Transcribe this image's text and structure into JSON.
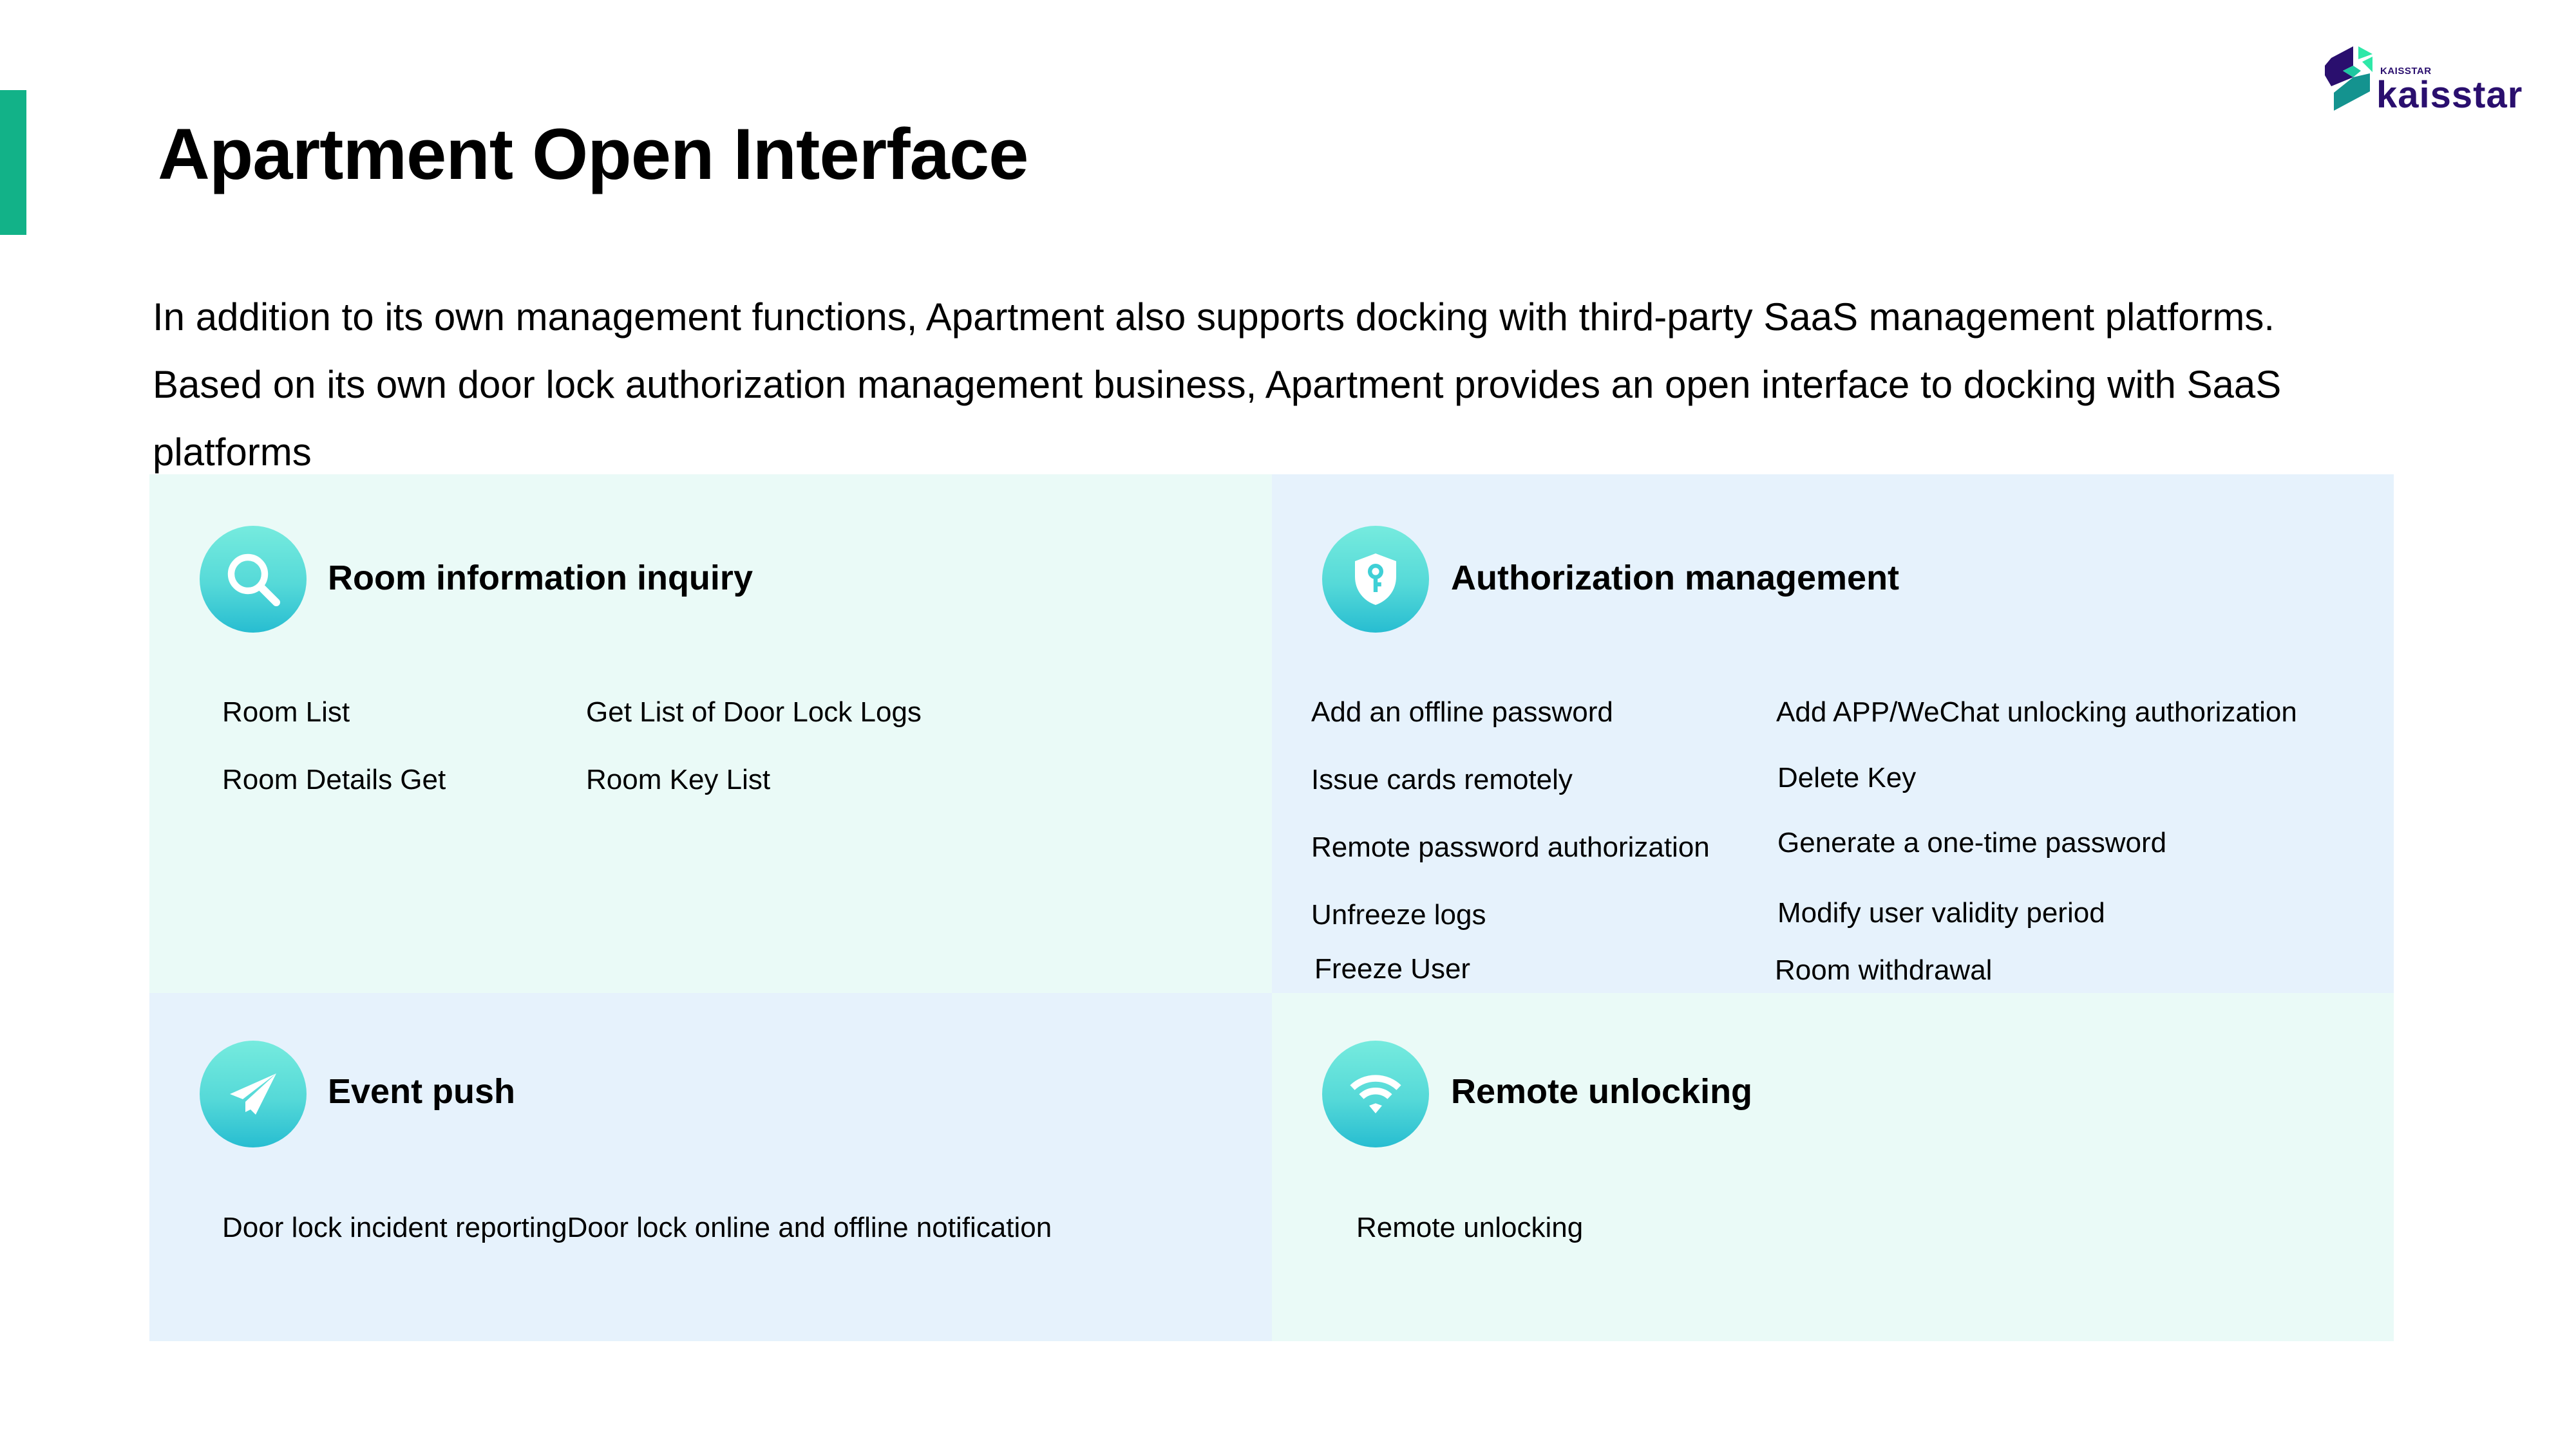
{
  "header": {
    "title": "Apartment Open Interface",
    "logo": {
      "small_text": "KAISSTAR",
      "wordmark": "kaisstar"
    },
    "intro_lines": [
      "In addition to its own management functions, Apartment also supports docking with third-party SaaS management platforms.",
      "Based on its own door lock authorization management business, Apartment provides an open interface to docking with SaaS",
      "platforms"
    ]
  },
  "colors": {
    "accent": "#12b288",
    "brand_dark": "#2a0f6e",
    "icon_gradient_top": "#76ebde",
    "icon_gradient_bottom": "#27bdd1",
    "panel_mint": "#eafaf7",
    "panel_blue": "#e6f2fc"
  },
  "panels": [
    {
      "title": "Room information inquiry",
      "icon": "search-icon",
      "items": [
        "Room List",
        "Get List of Door Lock Logs",
        "Room Details Get",
        "Room Key List"
      ]
    },
    {
      "title": "Authorization management",
      "icon": "shield-key-icon",
      "items": [
        "Add an offline password",
        "Add APP/WeChat unlocking authorization",
        "Issue cards remotely",
        "Delete Key",
        "Remote password authorization",
        "Generate a one-time password",
        "Unfreeze logs",
        "Modify user validity period",
        "Freeze User",
        "Room withdrawal"
      ]
    },
    {
      "title": "Event push",
      "icon": "paper-plane-icon",
      "items": [
        "Door lock incident reportingDoor lock online and offline notification"
      ]
    },
    {
      "title": "Remote unlocking",
      "icon": "wifi-icon",
      "items": [
        "Remote unlocking"
      ]
    }
  ]
}
